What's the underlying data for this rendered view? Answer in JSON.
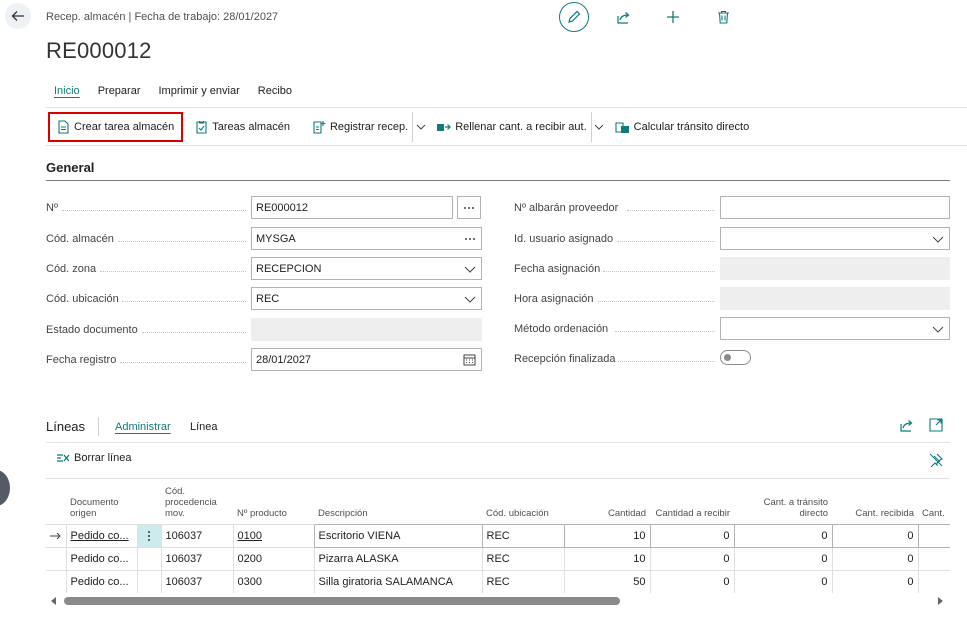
{
  "header": {
    "breadcrumb": "Recep. almacén | Fecha de trabajo: 28/01/2027",
    "title": "RE000012"
  },
  "tabs": [
    {
      "label": "Inicio"
    },
    {
      "label": "Preparar"
    },
    {
      "label": "Imprimir y enviar"
    },
    {
      "label": "Recibo"
    }
  ],
  "toolbar": {
    "create_task": "Crear tarea almacén",
    "warehouse_tasks": "Tareas almacén",
    "post_receipt": "Registrar recep.",
    "autofill_qty": "Rellenar cant. a recibir aut.",
    "calc_crossdock": "Calcular tránsito directo"
  },
  "general": {
    "title": "General",
    "no_label": "Nº",
    "no_value": "RE000012",
    "location_label": "Cód. almacén",
    "location_value": "MYSGA",
    "zone_label": "Cód. zona",
    "zone_value": "RECEPCION",
    "bin_label": "Cód. ubicación",
    "bin_value": "REC",
    "status_label": "Estado documento",
    "status_value": "",
    "posting_date_label": "Fecha registro",
    "posting_date_value": "28/01/2027",
    "vendor_shipment_label": "Nº albarán proveedor",
    "vendor_shipment_value": "",
    "assigned_user_label": "Id. usuario asignado",
    "assigned_user_value": "",
    "assignment_date_label": "Fecha asignación",
    "assignment_time_label": "Hora asignación",
    "sorting_method_label": "Método ordenación",
    "sorting_method_value": "",
    "receipt_completed_label": "Recepción finalizada",
    "receipt_completed": false
  },
  "lines": {
    "title": "Líneas",
    "tab_manage": "Administrar",
    "tab_line": "Línea",
    "delete_line": "Borrar línea",
    "columns": {
      "source_doc": "Documento origen",
      "source_code": "Cód. procedencia mov.",
      "item_no": "Nº producto",
      "description": "Descripción",
      "bin_code": "Cód. ubicación",
      "quantity": "Cantidad",
      "qty_to_receive": "Cantidad a recibir",
      "qty_crossdock": "Cant. a tránsito directo",
      "qty_received": "Cant. recibida",
      "qty_extra": "Cant."
    },
    "rows": [
      {
        "source_doc": "Pedido co...",
        "source_code": "106037",
        "item_no": "0100",
        "description": "Escritorio VIENA",
        "bin_code": "REC",
        "quantity": "10",
        "qty_to_receive": "0",
        "qty_crossdock": "0",
        "qty_received": "0"
      },
      {
        "source_doc": "Pedido co...",
        "source_code": "106037",
        "item_no": "0200",
        "description": "Pizarra ALASKA",
        "bin_code": "REC",
        "quantity": "10",
        "qty_to_receive": "0",
        "qty_crossdock": "0",
        "qty_received": "0"
      },
      {
        "source_doc": "Pedido co...",
        "source_code": "106037",
        "item_no": "0300",
        "description": "Silla giratoria SALAMANCA",
        "bin_code": "REC",
        "quantity": "50",
        "qty_to_receive": "0",
        "qty_crossdock": "0",
        "qty_received": "0"
      }
    ]
  },
  "colors": {
    "accent": "#0f7b7b",
    "highlight_border": "#d50000"
  }
}
